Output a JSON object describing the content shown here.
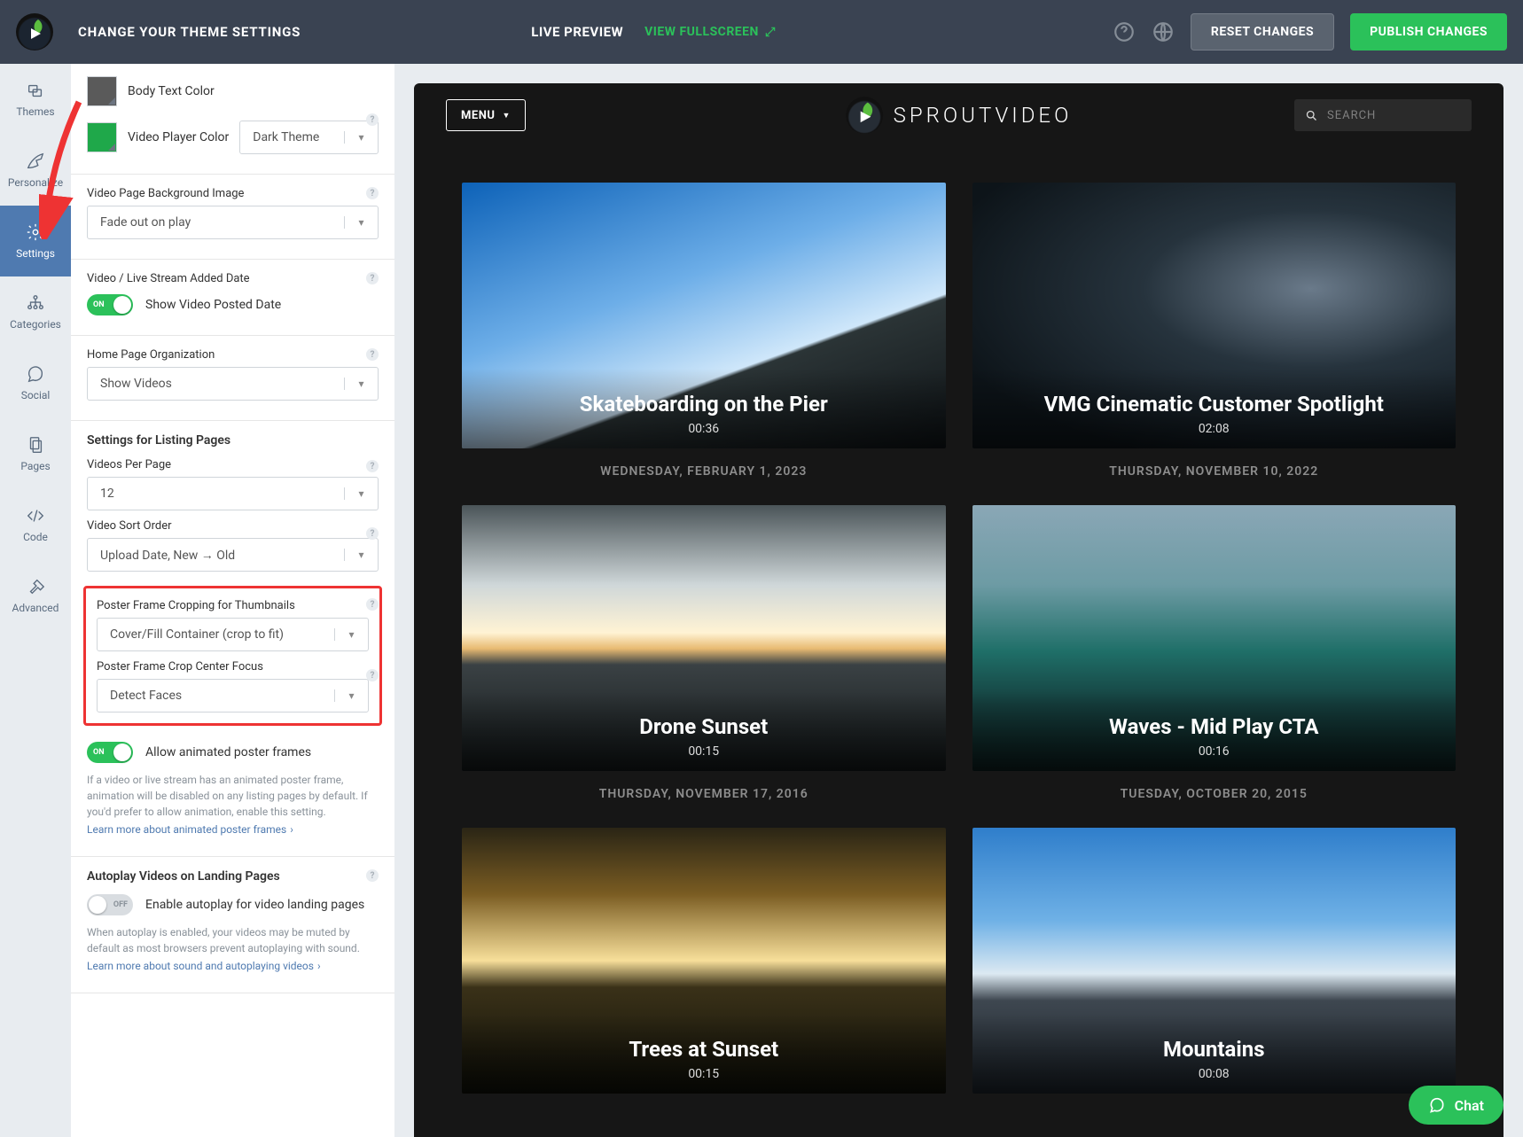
{
  "topbar": {
    "title": "CHANGE YOUR THEME SETTINGS",
    "live_preview": "LIVE PREVIEW",
    "view_fullscreen": "VIEW FULLSCREEN",
    "reset": "RESET CHANGES",
    "publish": "PUBLISH CHANGES"
  },
  "rail": {
    "items": [
      {
        "label": "Themes"
      },
      {
        "label": "Personalize"
      },
      {
        "label": "Settings"
      },
      {
        "label": "Categories"
      },
      {
        "label": "Social"
      },
      {
        "label": "Pages"
      },
      {
        "label": "Code"
      },
      {
        "label": "Advanced"
      }
    ]
  },
  "settings": {
    "body_text_color_label": "Body Text Color",
    "video_player_color_label": "Video Player Color",
    "video_player_color_value": "Dark Theme",
    "bg_image_label": "Video Page Background Image",
    "bg_image_value": "Fade out on play",
    "added_date_label": "Video / Live Stream Added Date",
    "added_date_toggle_text": "Show Video Posted Date",
    "added_date_toggle_state": "ON",
    "home_org_label": "Home Page Organization",
    "home_org_value": "Show Videos",
    "listing_header": "Settings for Listing Pages",
    "videos_per_page_label": "Videos Per Page",
    "videos_per_page_value": "12",
    "sort_label": "Video Sort Order",
    "sort_value": "Upload Date, New → Old",
    "crop_label": "Poster Frame Cropping for Thumbnails",
    "crop_value": "Cover/Fill Container (crop to fit)",
    "focus_label": "Poster Frame Crop Center Focus",
    "focus_value": "Detect Faces",
    "anim_toggle_text": "Allow animated poster frames",
    "anim_toggle_state": "ON",
    "anim_note": "If a video or live stream has an animated poster frame, animation will be disabled on any listing pages by default. If you'd prefer to allow animation, enable this setting.",
    "anim_link": "Learn more about animated poster frames",
    "autoplay_header": "Autoplay Videos on Landing Pages",
    "autoplay_toggle_text": "Enable autoplay for video landing pages",
    "autoplay_toggle_state": "OFF",
    "autoplay_note": "When autoplay is enabled, your videos may be muted by default as most browsers prevent autoplaying with sound.",
    "autoplay_link": "Learn more about sound and autoplaying videos"
  },
  "preview": {
    "menu": "MENU",
    "brand": "SPROUTVIDEO",
    "search_placeholder": "SEARCH",
    "videos": [
      {
        "title": "Skateboarding on the Pier",
        "duration": "00:36",
        "date": "WEDNESDAY, FEBRUARY 1, 2023",
        "bg": "bg1"
      },
      {
        "title": "VMG Cinematic Customer Spotlight",
        "duration": "02:08",
        "date": "THURSDAY, NOVEMBER 10, 2022",
        "bg": "bg2"
      },
      {
        "title": "Drone Sunset",
        "duration": "00:15",
        "date": "THURSDAY, NOVEMBER 17, 2016",
        "bg": "bg3"
      },
      {
        "title": "Waves - Mid Play CTA",
        "duration": "00:16",
        "date": "TUESDAY, OCTOBER 20, 2015",
        "bg": "bg4"
      },
      {
        "title": "Trees at Sunset",
        "duration": "00:15",
        "date": "",
        "bg": "bg5"
      },
      {
        "title": "Mountains",
        "duration": "00:08",
        "date": "",
        "bg": "bg6"
      }
    ]
  },
  "chat": {
    "label": "Chat"
  }
}
